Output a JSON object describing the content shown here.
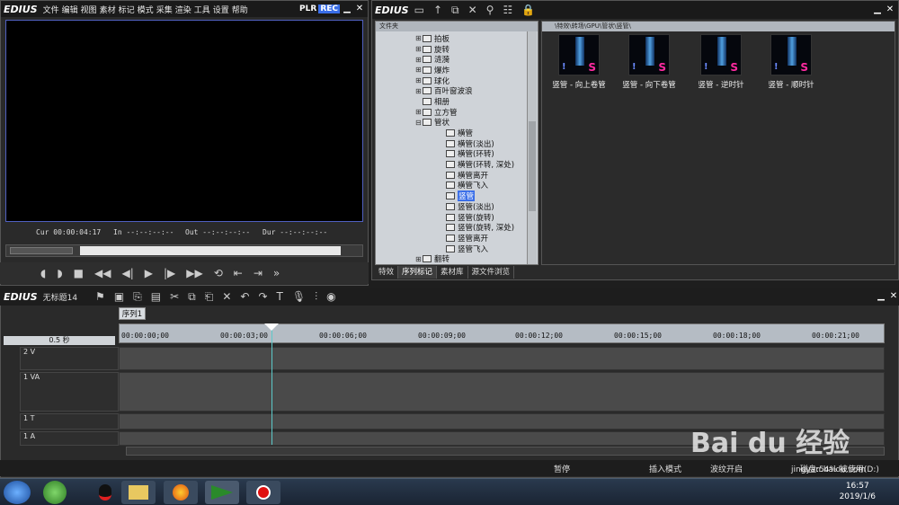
{
  "player": {
    "logo": "EDIUS",
    "menu": [
      "文件",
      "编辑",
      "视图",
      "素材",
      "标记",
      "模式",
      "采集",
      "渲染",
      "工具",
      "设置",
      "帮助"
    ],
    "plr": "PLR",
    "rec": "REC",
    "timecodes": [
      {
        "label": "Cur",
        "value": "00:00:04:17"
      },
      {
        "label": "In",
        "value": "--:--:--:--"
      },
      {
        "label": "Out",
        "value": "--:--:--:--"
      },
      {
        "label": "Dur",
        "value": "--:--:--:--"
      }
    ]
  },
  "bin": {
    "logo": "EDIUS",
    "folder_header": "文件夹",
    "path": "\\特效\\转场\\GPU\\管状\\竖管\\",
    "tree": [
      {
        "label": "拍板",
        "expand": "⊞"
      },
      {
        "label": "旋转",
        "expand": "⊞"
      },
      {
        "label": "涟漪",
        "expand": "⊞"
      },
      {
        "label": "爆炸",
        "expand": "⊞"
      },
      {
        "label": "球化",
        "expand": "⊞"
      },
      {
        "label": "百叶窗波浪",
        "expand": "⊞"
      },
      {
        "label": "相册",
        "expand": ""
      },
      {
        "label": "立方管",
        "expand": "⊞"
      },
      {
        "label": "管状",
        "expand": "⊟"
      },
      {
        "label": "横管",
        "expand": ""
      },
      {
        "label": "横管(淡出)",
        "expand": ""
      },
      {
        "label": "横管(环转)",
        "expand": ""
      },
      {
        "label": "横管(环转, 深处)",
        "expand": ""
      },
      {
        "label": "横管离开",
        "expand": ""
      },
      {
        "label": "横管飞入",
        "expand": ""
      },
      {
        "label": "竖管",
        "expand": ""
      },
      {
        "label": "竖管(淡出)",
        "expand": ""
      },
      {
        "label": "竖管(旋转)",
        "expand": ""
      },
      {
        "label": "竖管(旋转, 深处)",
        "expand": ""
      },
      {
        "label": "竖管离开",
        "expand": ""
      },
      {
        "label": "竖管飞入",
        "expand": ""
      },
      {
        "label": "翻转",
        "expand": "⊞"
      }
    ],
    "thumbs": [
      {
        "label": "竖管 - 向上卷管"
      },
      {
        "label": "竖管 - 向下卷管"
      },
      {
        "label": "竖管 - 逆时针"
      },
      {
        "label": "竖管 - 顺时针"
      }
    ],
    "tabs": [
      "特效",
      "序列标记",
      "素材库",
      "源文件浏览"
    ]
  },
  "timeline": {
    "logo": "EDIUS",
    "project": "无标题14",
    "sequence_tab": "序列1",
    "zoom": "0.5 秒",
    "ruler": [
      "00:00:00;00",
      "00:00:03;00",
      "00:00:06;00",
      "00:00:09;00",
      "00:00:12;00",
      "00:00:15;00",
      "00:00:18;00",
      "00:00:21;00"
    ],
    "tracks": [
      "2 V",
      "1 VA",
      "1 T",
      "1 A"
    ],
    "status": {
      "pause": "暂停",
      "insert": "插入模式",
      "ripple": "波纹开启",
      "disk": "磁盘:54% 被使用(D:)"
    }
  },
  "taskbar": {
    "time": "16:57",
    "date": "2019/1/6"
  },
  "watermark": {
    "brand": "Bai du 经验",
    "url": "jingyan.baidu.com"
  }
}
